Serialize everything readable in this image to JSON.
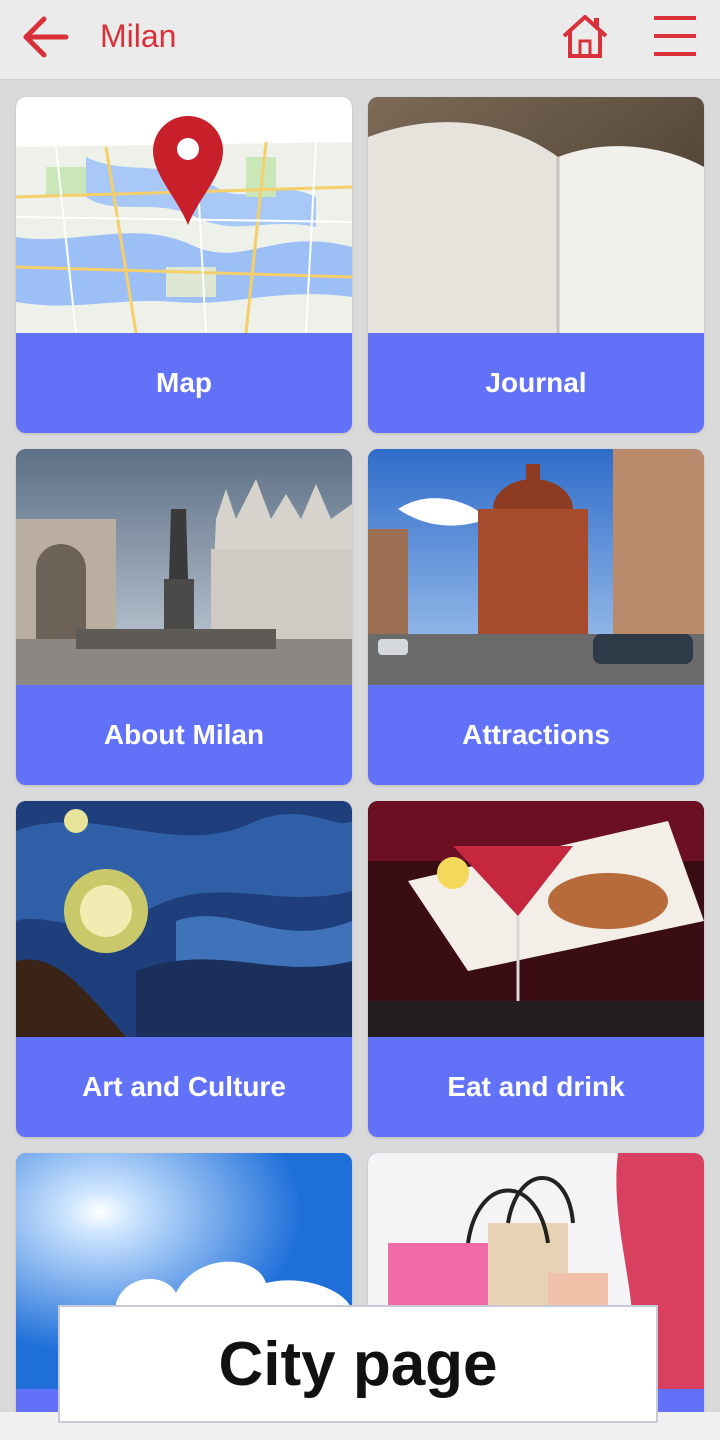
{
  "header": {
    "title": "Milan",
    "accent_color": "#d9313a",
    "back_icon": "arrow-left-icon",
    "home_icon": "home-icon",
    "menu_icon": "hamburger-menu-icon"
  },
  "tiles": [
    {
      "label": "Map",
      "image": "map-with-pin"
    },
    {
      "label": "Journal",
      "image": "open-notebook"
    },
    {
      "label": "About Milan",
      "image": "milan-cathedral-square"
    },
    {
      "label": "Attractions",
      "image": "church-street"
    },
    {
      "label": "Art and Culture",
      "image": "starry-night-painting"
    },
    {
      "label": "Eat and drink",
      "image": "cocktail-and-salmon-plate"
    },
    {
      "label": "",
      "image": "sun-sky-clouds"
    },
    {
      "label": "",
      "image": "shopping-bags"
    }
  ],
  "tile_color": "#6272f8",
  "caption": "City page"
}
